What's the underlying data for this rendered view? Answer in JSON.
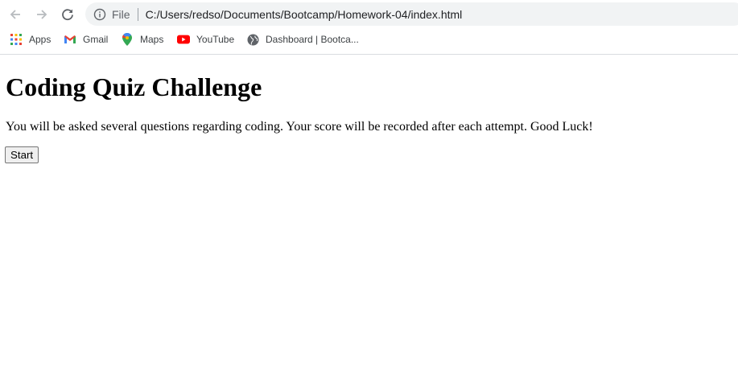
{
  "browser": {
    "address_bar": {
      "scheme_label": "File",
      "url": "C:/Users/redso/Documents/Bootcamp/Homework-04/index.html"
    },
    "bookmarks": [
      {
        "label": "Apps",
        "icon": "apps-grid-icon"
      },
      {
        "label": "Gmail",
        "icon": "gmail-icon"
      },
      {
        "label": "Maps",
        "icon": "maps-pin-icon"
      },
      {
        "label": "YouTube",
        "icon": "youtube-icon"
      },
      {
        "label": "Dashboard | Bootca...",
        "icon": "globe-icon"
      }
    ]
  },
  "page": {
    "title": "Coding Quiz Challenge",
    "description": "You will be asked several questions regarding coding. Your score will be recorded after each attempt. Good Luck!",
    "start_button": "Start"
  }
}
